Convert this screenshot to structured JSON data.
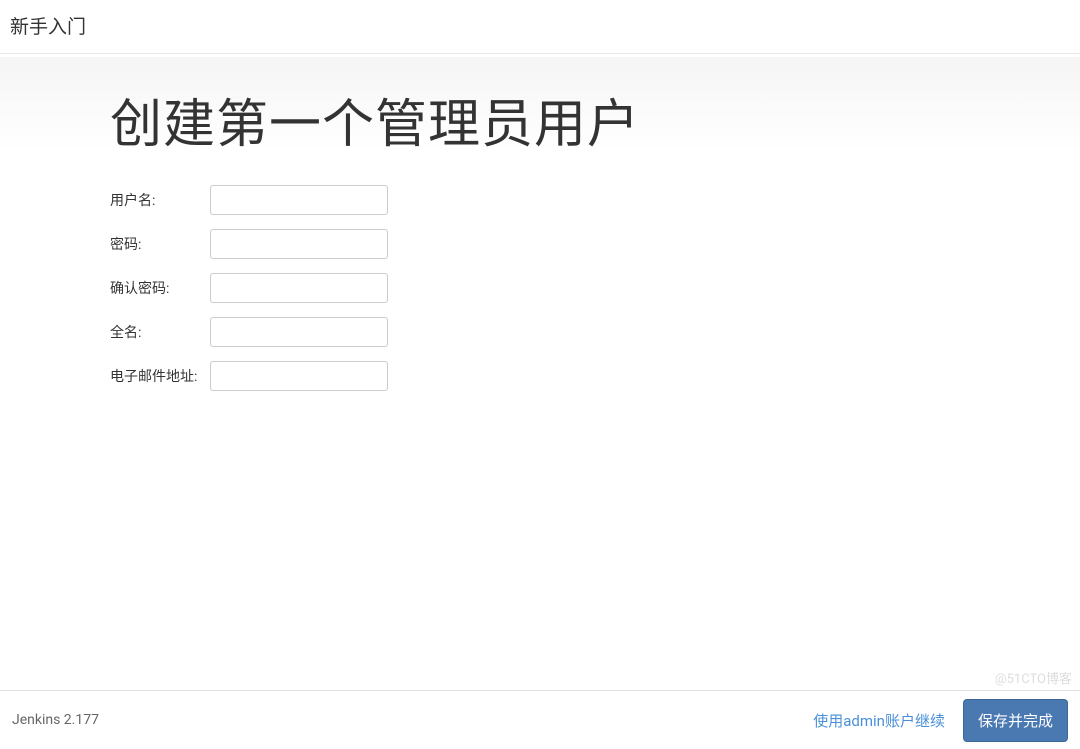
{
  "header": {
    "title": "新手入门"
  },
  "main": {
    "title": "创建第一个管理员用户",
    "form": {
      "username": {
        "label": "用户名:",
        "value": ""
      },
      "password": {
        "label": "密码:",
        "value": ""
      },
      "confirm_password": {
        "label": "确认密码:",
        "value": ""
      },
      "fullname": {
        "label": "全名:",
        "value": ""
      },
      "email": {
        "label": "电子邮件地址:",
        "value": ""
      }
    }
  },
  "footer": {
    "version": "Jenkins 2.177",
    "continue_as_admin": "使用admin账户继续",
    "save_and_finish": "保存并完成"
  },
  "watermark": "@51CTO博客"
}
